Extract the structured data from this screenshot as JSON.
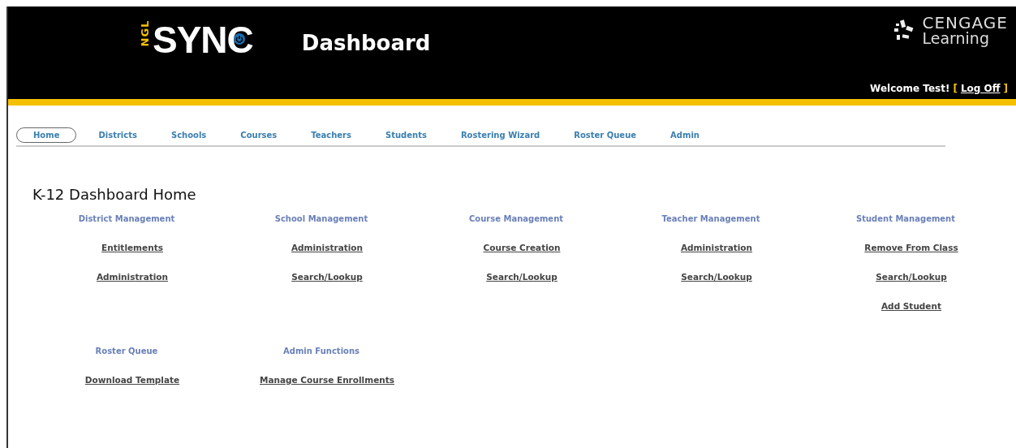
{
  "header": {
    "logo": {
      "prefix": "NGL",
      "name": "SYNC"
    },
    "title": "Dashboard",
    "brand": {
      "name": "CENGAGE",
      "sub": "Learning"
    },
    "welcome": "Welcome Test!",
    "open_bracket": "[",
    "logoff": "Log Off",
    "close_bracket": "]"
  },
  "tabs": [
    {
      "label": "Home",
      "selected": true
    },
    {
      "label": "Districts",
      "selected": false
    },
    {
      "label": "Schools",
      "selected": false
    },
    {
      "label": "Courses",
      "selected": false
    },
    {
      "label": "Teachers",
      "selected": false
    },
    {
      "label": "Students",
      "selected": false
    },
    {
      "label": "Rostering Wizard",
      "selected": false
    },
    {
      "label": "Roster Queue",
      "selected": false
    },
    {
      "label": "Admin",
      "selected": false
    }
  ],
  "page_title": "K-12 Dashboard Home",
  "section_rows": [
    [
      {
        "title": "District Management",
        "links": [
          "Entitlements",
          "Administration"
        ]
      },
      {
        "title": "School Management",
        "links": [
          "Administration",
          "Search/Lookup"
        ]
      },
      {
        "title": "Course Management",
        "links": [
          "Course Creation",
          "Search/Lookup"
        ]
      },
      {
        "title": "Teacher Management",
        "links": [
          "Administration",
          "Search/Lookup"
        ]
      },
      {
        "title": "Student Management",
        "links": [
          "Remove From Class",
          "Search/Lookup",
          "Add Student"
        ]
      }
    ],
    [
      {
        "title": "Roster Queue",
        "links": [
          "Download Template"
        ]
      },
      {
        "title": "Admin Functions",
        "links": [
          "Manage Course Enrollments"
        ]
      }
    ]
  ]
}
